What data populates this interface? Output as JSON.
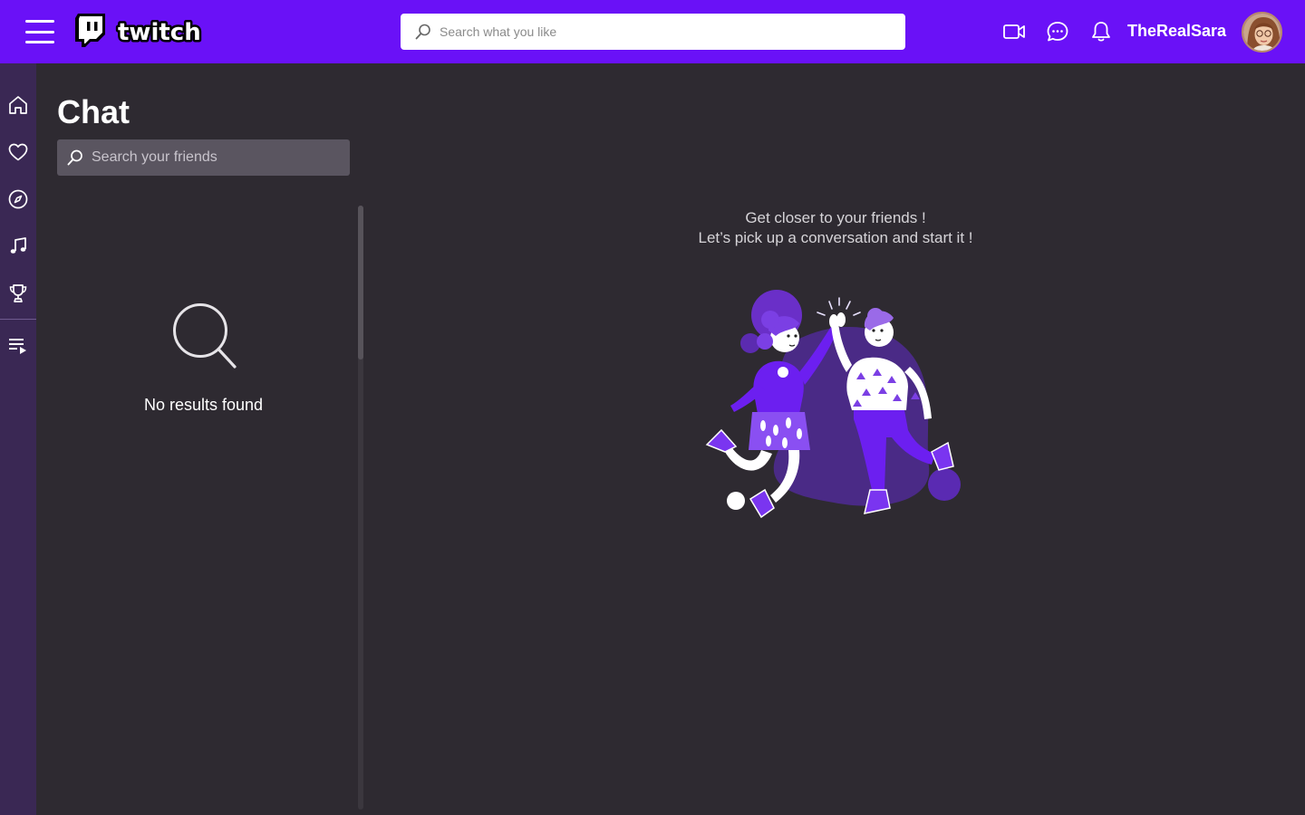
{
  "app": {
    "logo_text": "twitch",
    "brand_color": "#6a11f7"
  },
  "header": {
    "search_placeholder": "Search what you like",
    "username": "TheRealSara",
    "icons": [
      "menu-icon",
      "video-camera-icon",
      "chat-bubble-icon",
      "bell-icon"
    ]
  },
  "sidebar": {
    "items": [
      {
        "icon": "home-icon"
      },
      {
        "icon": "heart-icon"
      },
      {
        "icon": "compass-icon"
      },
      {
        "icon": "music-note-icon"
      },
      {
        "icon": "trophy-icon"
      },
      {
        "icon": "playlist-icon"
      }
    ]
  },
  "chat": {
    "title": "Chat",
    "search_placeholder": "Search your friends",
    "empty_text": "No results found",
    "prompt_line1": "Get closer to your friends !",
    "prompt_line2": "Let’s pick up a conversation and start it !"
  }
}
